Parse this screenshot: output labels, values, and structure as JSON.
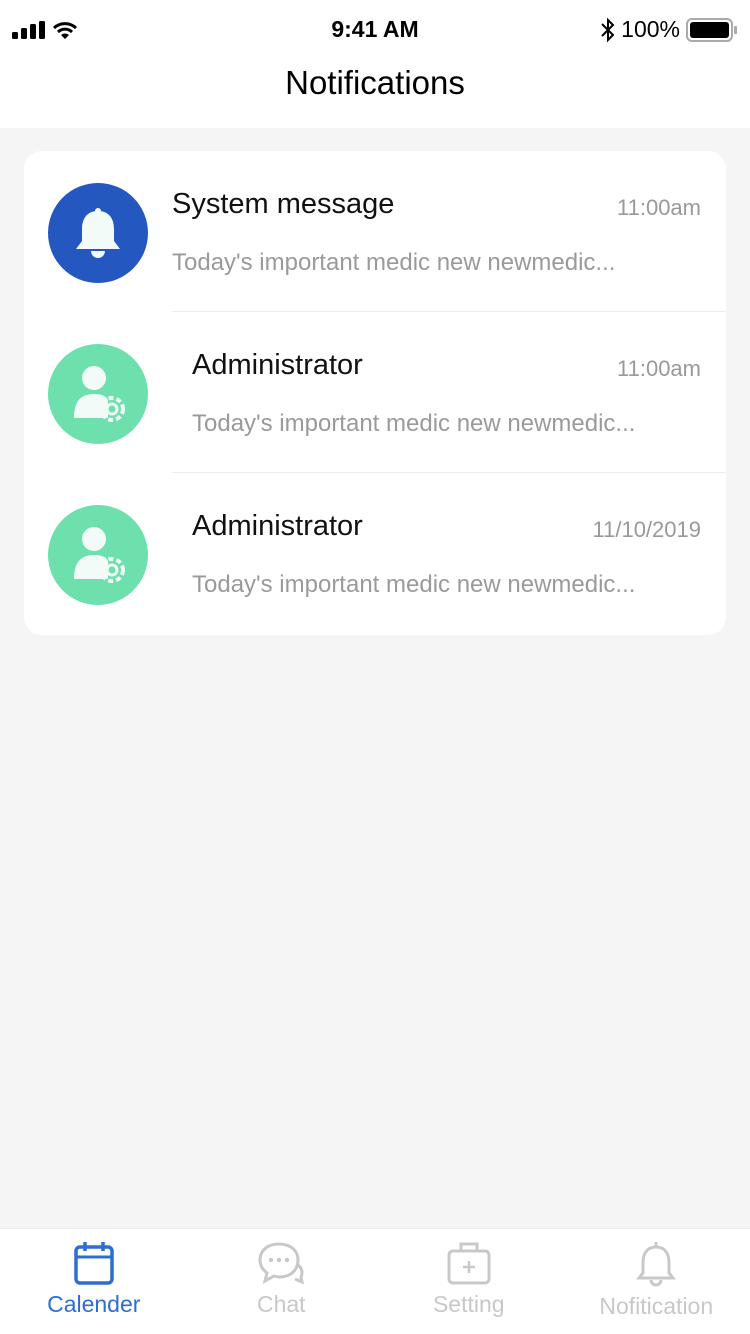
{
  "status_bar": {
    "time": "9:41 AM",
    "battery": "100%",
    "icons": [
      "signal-icon",
      "wifi-icon",
      "bluetooth-icon",
      "battery-icon"
    ]
  },
  "header": {
    "title": "Notifications"
  },
  "notifications": [
    {
      "avatar_icon": "bell-icon",
      "avatar_color": "#2557c0",
      "name": "System message",
      "time": "11:00am",
      "preview": "Today's important medic new   newmedic..."
    },
    {
      "avatar_icon": "admin-user-gear-icon",
      "avatar_color": "#6de0ad",
      "name": "Administrator",
      "time": "11:00am",
      "preview": "Today's important medic new   newmedic..."
    },
    {
      "avatar_icon": "admin-user-gear-icon",
      "avatar_color": "#6de0ad",
      "name": "Administrator",
      "time": "11/10/2019",
      "preview": "Today's important medic new   newmedic..."
    }
  ],
  "tabbar": {
    "active_color": "#2c6fd1",
    "inactive_color": "#c8c8c8",
    "tabs": [
      {
        "label": "Calender",
        "icon": "calendar-icon",
        "active": true
      },
      {
        "label": "Chat",
        "icon": "chat-icon",
        "active": false
      },
      {
        "label": "Setting",
        "icon": "medical-kit-icon",
        "active": false
      },
      {
        "label": "Nofitication",
        "icon": "bell-icon",
        "active": false
      }
    ]
  }
}
